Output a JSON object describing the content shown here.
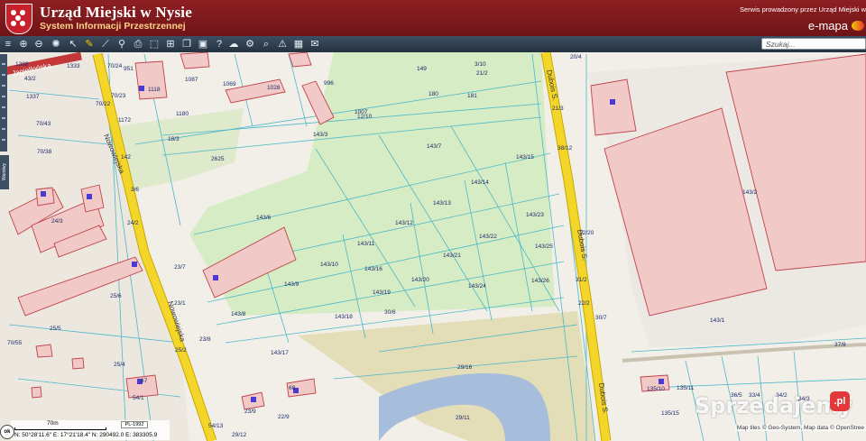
{
  "header": {
    "title": "Urząd Miejski w Nysie",
    "subtitle": "System Informacji Przestrzennej",
    "service_note": "Serwis prowadzony przez Urząd Miejski w N",
    "brand": "e-mapa"
  },
  "toolbar": {
    "tools": [
      "layers-icon",
      "zoom-in-icon",
      "zoom-out-icon",
      "full-extent-icon",
      "pointer-icon",
      "pencil-icon",
      "measure-icon",
      "link-icon",
      "print-icon",
      "export-icon",
      "select-icon",
      "cloud-icon",
      "settings-icon",
      "find-icon",
      "help-icon",
      "warning-icon",
      "grid-icon",
      "comment-icon"
    ],
    "search_placeholder": "Szukaj..."
  },
  "side_panel": {
    "layers_label": "Warstwy"
  },
  "streets": {
    "nowowiejska": "Nowowiejska",
    "jagiellonska": "Jagiellońska",
    "dubois": "Dubois S."
  },
  "parcels": [
    "149",
    "3/10",
    "21/2",
    "20/4",
    "180",
    "181",
    "1007",
    "12/10",
    "143/3",
    "143/7",
    "143/15",
    "143/14",
    "143/13",
    "143/12",
    "143/23",
    "143/22",
    "143/21",
    "143/11",
    "143/16",
    "143/10",
    "143/20",
    "143/24",
    "143/26",
    "143/25",
    "143/9",
    "143/19",
    "143/8",
    "143/18",
    "143/17",
    "30/6",
    "29/16",
    "29/11",
    "143/6",
    "2625",
    "18/3",
    "1180",
    "1087",
    "1069",
    "1028",
    "996",
    "1118",
    "1172",
    "70/24",
    "951",
    "1333",
    "1337",
    "70/23",
    "70/22",
    "70/43",
    "70/38",
    "24/3",
    "24/2",
    "23/7",
    "23/1",
    "25/6",
    "25/5",
    "25/2",
    "23/8",
    "25/4",
    "54/1",
    "70/55",
    "23/9",
    "22/9",
    "29/12",
    "54/13",
    "3/6",
    "43/2",
    "1388",
    "143/2",
    "143/1",
    "38/12",
    "21/3",
    "12/20",
    "31/2",
    "22/2",
    "30/7",
    "37/8",
    "135/10",
    "135/11",
    "135/15",
    "36/5",
    "33/4",
    "34/2",
    "34/3",
    "142",
    "68",
    "67"
  ],
  "status": {
    "coords": "N: 50°28'11.6\"  E: 17°21'18.4\"  N: 290492.0  E: 383305.9",
    "scale": "70m",
    "projection": "PL-1992",
    "ok_label": "ok",
    "attribution": "Map tiles © Geo-System, Map data © OpenStree",
    "attribution2": "Mapa data © OpenStreetMap",
    "watermark": "Sprzedajemy"
  },
  "colors": {
    "header": "#7e1a1d",
    "toolbar": "#3d4f63",
    "road": "#f4d62a",
    "parcel_line": "#4db8c8",
    "building": "#f1c9c6",
    "building_border": "#c2424a",
    "green": "#d6ecc4",
    "water": "#a6bedc"
  }
}
